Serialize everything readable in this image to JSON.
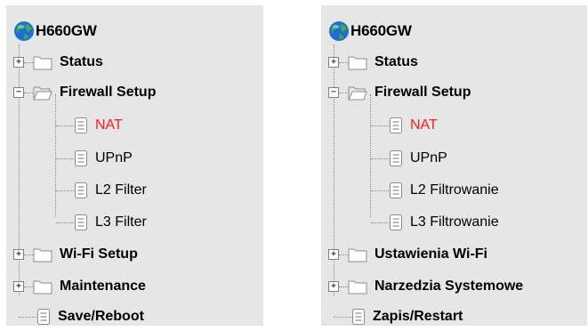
{
  "left_tree": {
    "root": "H660GW",
    "status": "Status",
    "firewall_setup": "Firewall Setup",
    "nat": "NAT",
    "upnp": "UPnP",
    "l2_filter": "L2 Filter",
    "l3_filter": "L3 Filter",
    "wifi_setup": "Wi-Fi Setup",
    "maintenance": "Maintenance",
    "save_reboot": "Save/Reboot"
  },
  "right_tree": {
    "root": "H660GW",
    "status": "Status",
    "firewall_setup": "Firewall Setup",
    "nat": "NAT",
    "upnp": "UPnP",
    "l2_filter": "L2 Filtrowanie",
    "l3_filter": "L3 Filtrowanie",
    "wifi_setup": "Ustawienia Wi-Fi",
    "maintenance": "Narzedzia Systemowe",
    "save_reboot": "Zapis/Restart"
  },
  "expander": {
    "plus": "+",
    "minus": "−"
  },
  "colors": {
    "active_item": "#ff1a1a",
    "panel_bg": "#e6e6e6"
  },
  "icons": [
    "globe-icon",
    "folder-icon",
    "folder-open-icon",
    "document-icon",
    "expand-plus-icon",
    "collapse-minus-icon"
  ]
}
